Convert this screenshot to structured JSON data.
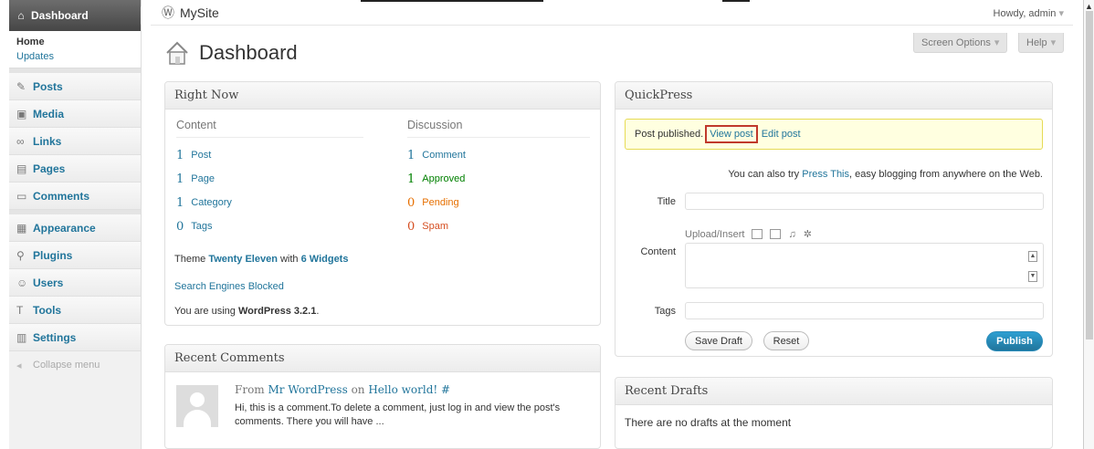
{
  "admin_bar": {
    "site_name": "MySite",
    "howdy": "Howdy, admin",
    "howdy_arrow": "▾"
  },
  "sidebar": {
    "dashboard_label": "Dashboard",
    "submenu": [
      {
        "label": "Home"
      },
      {
        "label": "Updates"
      }
    ],
    "items": [
      {
        "label": "Posts",
        "icon": "pushpin-icon"
      },
      {
        "label": "Media",
        "icon": "media-icon"
      },
      {
        "label": "Links",
        "icon": "link-icon"
      },
      {
        "label": "Pages",
        "icon": "pages-icon"
      },
      {
        "label": "Comments",
        "icon": "comment-icon"
      },
      {
        "label": "Appearance",
        "icon": "appearance-icon"
      },
      {
        "label": "Plugins",
        "icon": "plug-icon"
      },
      {
        "label": "Users",
        "icon": "users-icon"
      },
      {
        "label": "Tools",
        "icon": "tools-icon"
      },
      {
        "label": "Settings",
        "icon": "settings-icon"
      }
    ],
    "collapse_label": "Collapse menu"
  },
  "header": {
    "title": "Dashboard",
    "screen_options": "Screen Options",
    "help": "Help",
    "arrow": "▾"
  },
  "right_now": {
    "title": "Right Now",
    "content_heading": "Content",
    "discussion_heading": "Discussion",
    "content_rows": [
      {
        "count": "1",
        "label": "Post"
      },
      {
        "count": "1",
        "label": "Page"
      },
      {
        "count": "1",
        "label": "Category"
      },
      {
        "count": "0",
        "label": "Tags"
      }
    ],
    "discussion_rows": [
      {
        "count": "1",
        "label": "Comment"
      },
      {
        "count": "1",
        "label": "Approved"
      },
      {
        "count": "0",
        "label": "Pending"
      },
      {
        "count": "0",
        "label": "Spam"
      }
    ],
    "theme_prefix": "Theme",
    "theme_name": "Twenty Eleven",
    "theme_with": "with",
    "widgets": "6 Widgets",
    "search_engines": "Search Engines Blocked",
    "version_prefix": "You are using",
    "version": "WordPress 3.2.1",
    "version_suffix": "."
  },
  "recent_comments": {
    "title": "Recent Comments",
    "from": "From",
    "author": "Mr WordPress",
    "on": "on",
    "post": "Hello world!",
    "hash": "#",
    "excerpt": "Hi, this is a comment.To delete a comment, just log in and view the post's comments. There you will have ..."
  },
  "quickpress": {
    "title": "QuickPress",
    "notice_text": "Post published.",
    "view_post": "View post",
    "edit_post": "Edit post",
    "try_prefix": "You can also try",
    "press_this": "Press This",
    "try_suffix": ", easy blogging from anywhere on the Web.",
    "title_label": "Title",
    "title_value": "",
    "upload_label": "Upload/Insert",
    "content_label": "Content",
    "content_value": "",
    "tags_label": "Tags",
    "tags_value": "",
    "save_draft": "Save Draft",
    "reset": "Reset",
    "publish": "Publish"
  },
  "recent_drafts": {
    "title": "Recent Drafts",
    "message": "There are no drafts at the moment"
  },
  "colors": {
    "link": "#21759b",
    "approved": "#008000",
    "pending": "#e66f00",
    "spam": "#d54e21",
    "notice_bg": "#ffffe0",
    "highlight": "#c0392b"
  }
}
